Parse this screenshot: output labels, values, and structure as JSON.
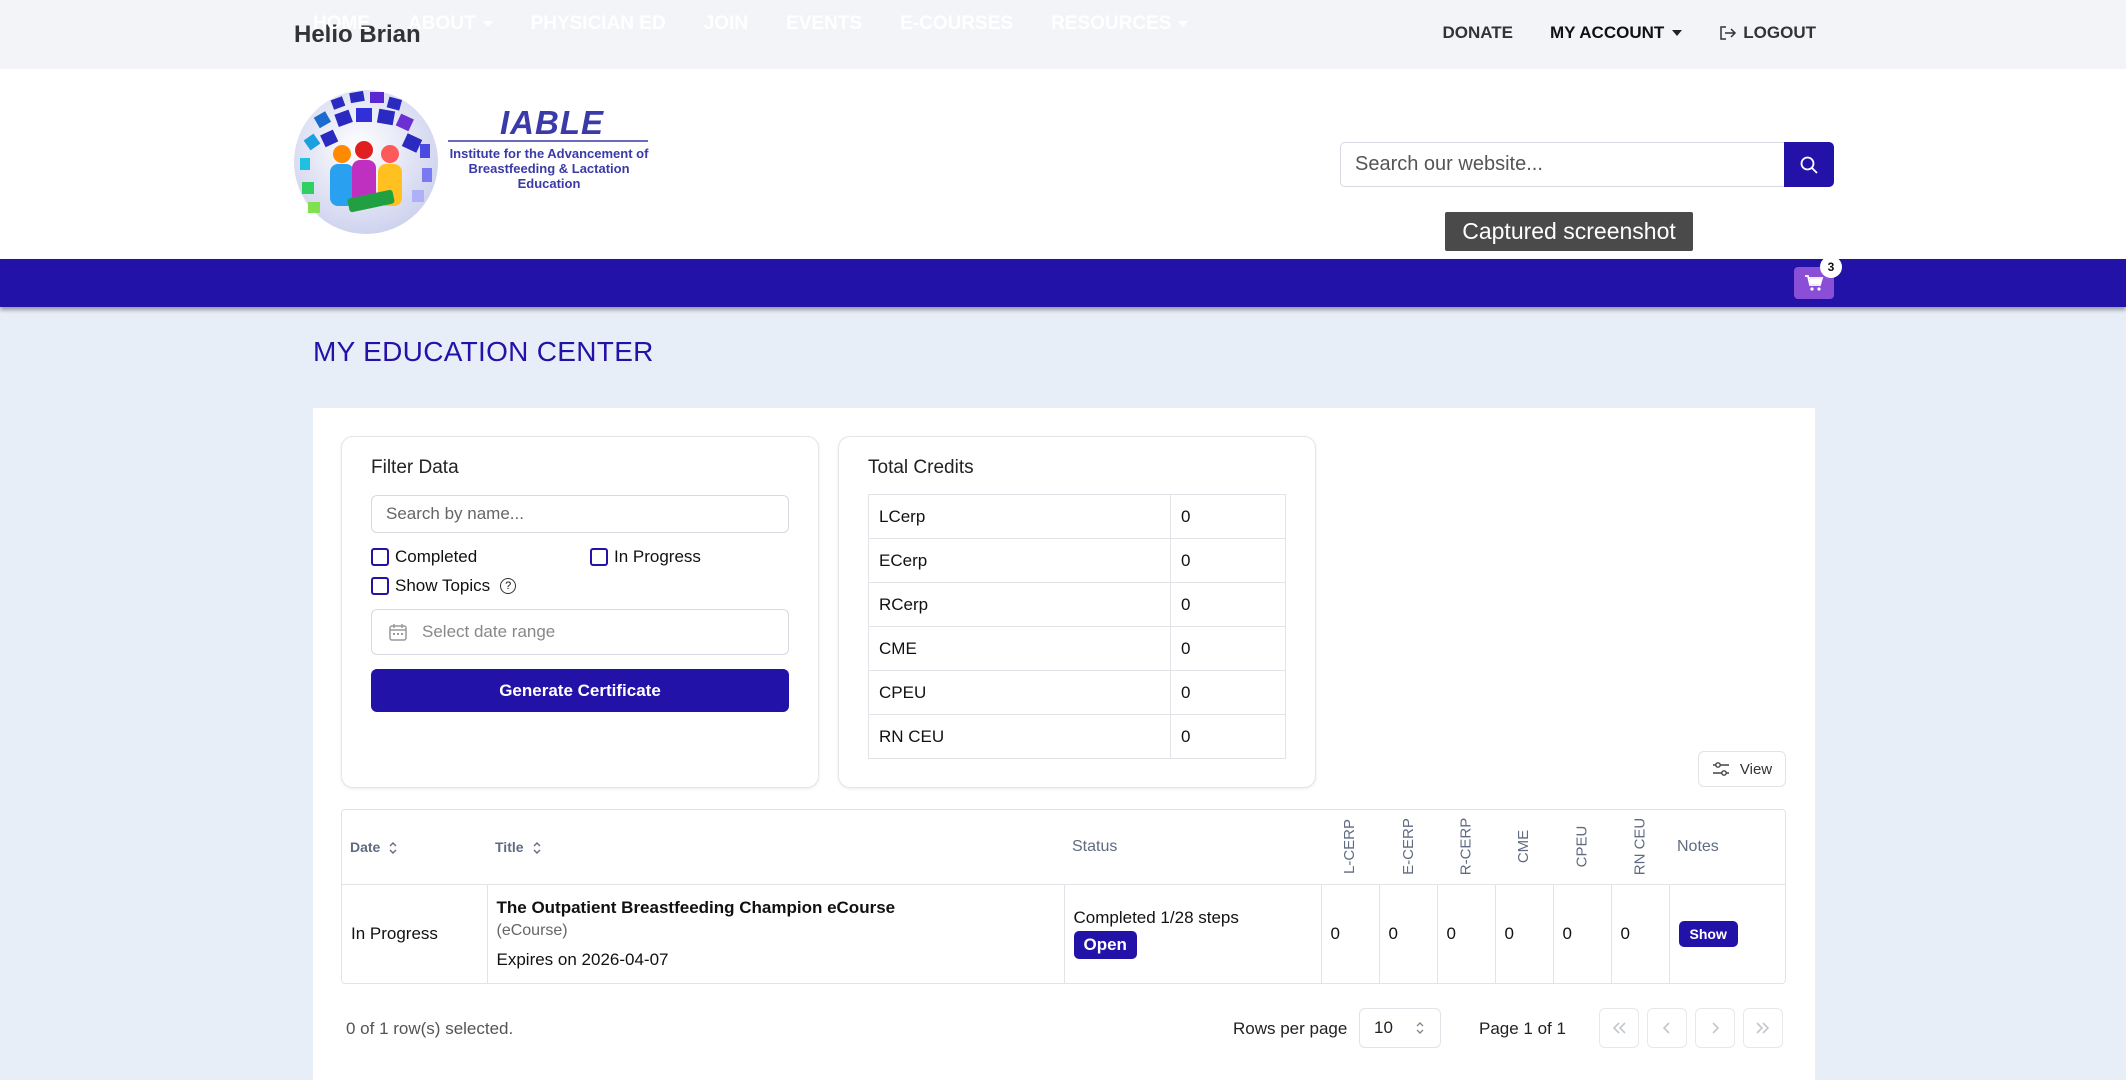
{
  "topbar": {
    "greeting": "Hello Brian",
    "donate": "DONATE",
    "my_account": "MY ACCOUNT",
    "logout": "LOGOUT"
  },
  "header": {
    "logo_title": "IABLE",
    "logo_sub": "Institute for the Advancement of Breastfeeding & Lactation Education",
    "search_placeholder": "Search our website...",
    "tooltip": "Captured screenshot"
  },
  "nav": {
    "items": [
      "HOME",
      "ABOUT",
      "PHYSICIAN ED",
      "JOIN",
      "EVENTS",
      "E-COURSES",
      "RESOURCES"
    ],
    "cart_count": "3"
  },
  "page": {
    "title": "MY EDUCATION CENTER"
  },
  "filter": {
    "title": "Filter Data",
    "search_placeholder": "Search by name...",
    "completed": "Completed",
    "in_progress": "In Progress",
    "show_topics": "Show Topics",
    "date_placeholder": "Select date range",
    "generate_button": "Generate Certificate"
  },
  "credits": {
    "title": "Total Credits",
    "rows": [
      {
        "label": "LCerp",
        "value": "0"
      },
      {
        "label": "ECerp",
        "value": "0"
      },
      {
        "label": "RCerp",
        "value": "0"
      },
      {
        "label": "CME",
        "value": "0"
      },
      {
        "label": "CPEU",
        "value": "0"
      },
      {
        "label": "RN CEU",
        "value": "0"
      }
    ]
  },
  "view_button": "View",
  "table": {
    "headers": {
      "date": "Date",
      "title": "Title",
      "status": "Status",
      "lcerp": "L-CERP",
      "ecerp": "E-CERP",
      "rcerp": "R-CERP",
      "cme": "CME",
      "cpeu": "CPEU",
      "rnceu": "RN CEU",
      "notes": "Notes"
    },
    "rows": [
      {
        "date": "In Progress",
        "title": "The Outpatient Breastfeeding Champion eCourse",
        "type": "(eCourse)",
        "expires": "Expires on 2026-04-07",
        "status": "Completed 1/28 steps",
        "open": "Open",
        "lcerp": "0",
        "ecerp": "0",
        "rcerp": "0",
        "cme": "0",
        "cpeu": "0",
        "rnceu": "0",
        "notes": "Show"
      }
    ]
  },
  "footer": {
    "selected": "0 of 1 row(s) selected.",
    "rows_per_page": "Rows per page",
    "rows_value": "10",
    "page_info": "Page 1 of 1"
  }
}
